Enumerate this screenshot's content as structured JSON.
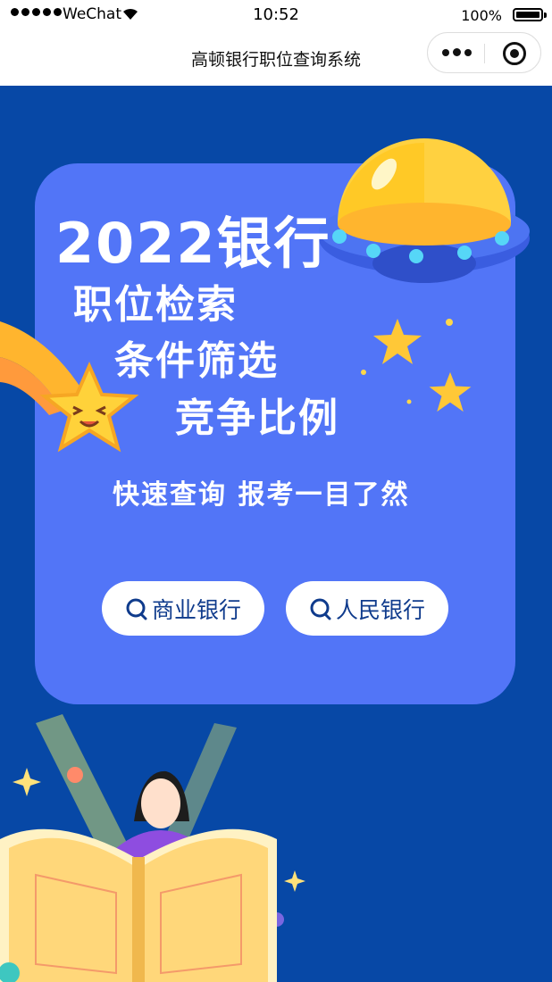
{
  "status_bar": {
    "carrier": "WeChat",
    "time": "10:52",
    "battery": "100%"
  },
  "nav": {
    "title": "高顿银行职位查询系统"
  },
  "hero": {
    "year_line": "2022银行",
    "line1": "职位检索",
    "line2": "条件筛选",
    "line3": "竞争比例",
    "tagline": "快速查询 报考一目了然"
  },
  "buttons": {
    "commercial_bank": "商业银行",
    "peoples_bank": "人民银行"
  },
  "colors": {
    "page_bg": "#0748a6",
    "card_bg": "#5275f7",
    "button_text": "#0f3b8c"
  }
}
